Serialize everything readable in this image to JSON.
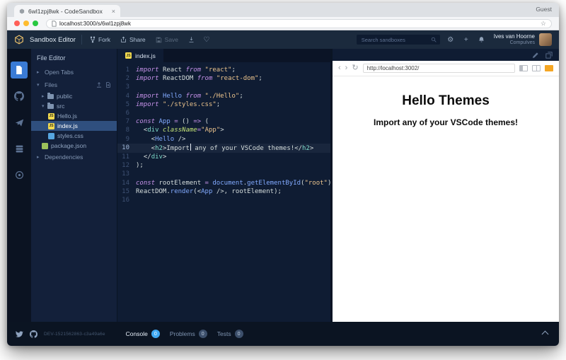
{
  "browser": {
    "tab_title": "6wl1zpj8wk - CodeSandbox",
    "close_tab": "×",
    "guest_label": "Guest",
    "url": "localhost:3000/s/6wl1zpj8wk"
  },
  "glyphs": {
    "heart": "♡",
    "gear": "⚙",
    "plus": "+",
    "star": "☆",
    "back": "‹",
    "forward": "›",
    "refresh": "↻",
    "chev_right": "▸",
    "chev_down": "▾"
  },
  "header": {
    "app_title": "Sandbox Editor",
    "actions": {
      "fork": "Fork",
      "share": "Share",
      "save": "Save"
    },
    "search_placeholder": "Search sandboxes",
    "user": {
      "name": "Ives van Hoorne",
      "handle": "CompuIves"
    }
  },
  "rail": {
    "items": [
      {
        "name": "files",
        "selected": true
      },
      {
        "name": "github",
        "selected": false
      },
      {
        "name": "deploy",
        "selected": false
      },
      {
        "name": "server",
        "selected": false
      },
      {
        "name": "live",
        "selected": false
      }
    ]
  },
  "explorer": {
    "title": "File Editor",
    "sections": {
      "open_tabs": "Open Tabs",
      "files": "Files",
      "dependencies": "Dependencies"
    },
    "items": [
      {
        "label": "public",
        "type": "folder",
        "depth": 1,
        "selected": false
      },
      {
        "label": "src",
        "type": "folder-open",
        "depth": 1,
        "selected": false
      },
      {
        "label": "Hello.js",
        "type": "js",
        "depth": 2,
        "selected": false
      },
      {
        "label": "index.js",
        "type": "js",
        "depth": 2,
        "selected": true
      },
      {
        "label": "styles.css",
        "type": "css",
        "depth": 2,
        "selected": false
      },
      {
        "label": "package.json",
        "type": "json",
        "depth": 1,
        "selected": false
      }
    ]
  },
  "editor": {
    "tab_label": "index.js",
    "active_line": 10,
    "lines": [
      [
        [
          "k",
          "import "
        ],
        [
          "v",
          "React "
        ],
        [
          "k",
          "from "
        ],
        [
          "s",
          "\"react\""
        ],
        [
          "p",
          ";"
        ]
      ],
      [
        [
          "k",
          "import "
        ],
        [
          "v",
          "ReactDOM "
        ],
        [
          "k",
          "from "
        ],
        [
          "s",
          "\"react-dom\""
        ],
        [
          "p",
          ";"
        ]
      ],
      [],
      [
        [
          "k",
          "import "
        ],
        [
          "f",
          "Hello "
        ],
        [
          "k",
          "from "
        ],
        [
          "s",
          "\"./Hello\""
        ],
        [
          "p",
          ";"
        ]
      ],
      [
        [
          "k",
          "import "
        ],
        [
          "s",
          "\"./styles.css\""
        ],
        [
          "p",
          ";"
        ]
      ],
      [],
      [
        [
          "k",
          "const "
        ],
        [
          "f",
          "App "
        ],
        [
          "o",
          "= "
        ],
        [
          "p",
          "() "
        ],
        [
          "o",
          "=> "
        ],
        [
          "p",
          "("
        ]
      ],
      [
        [
          "p",
          "  <"
        ],
        [
          "t",
          "div"
        ],
        [
          "v",
          " "
        ],
        [
          "a",
          "className"
        ],
        [
          "o",
          "="
        ],
        [
          "s",
          "\"App\""
        ],
        [
          "p",
          ">"
        ]
      ],
      [
        [
          "p",
          "    <"
        ],
        [
          "f",
          "Hello"
        ],
        [
          "p",
          " />"
        ]
      ],
      [
        [
          "p",
          "    <"
        ],
        [
          "t",
          "h2"
        ],
        [
          "p",
          ">"
        ],
        [
          "v",
          "Import"
        ],
        [
          "caret",
          ""
        ],
        [
          "v",
          " any of your VSCode themes!"
        ],
        [
          "p",
          "</"
        ],
        [
          "t",
          "h2"
        ],
        [
          "p",
          ">"
        ]
      ],
      [
        [
          "p",
          "  </"
        ],
        [
          "t",
          "div"
        ],
        [
          "p",
          ">"
        ]
      ],
      [
        [
          "p",
          ");"
        ]
      ],
      [],
      [
        [
          "k",
          "const "
        ],
        [
          "v",
          "rootElement "
        ],
        [
          "o",
          "= "
        ],
        [
          "f",
          "document"
        ],
        [
          "p",
          "."
        ],
        [
          "f",
          "getElementById"
        ],
        [
          "p",
          "("
        ],
        [
          "s",
          "\"root\""
        ],
        [
          "p",
          ");"
        ]
      ],
      [
        [
          "v",
          "ReactDOM"
        ],
        [
          "p",
          "."
        ],
        [
          "f",
          "render"
        ],
        [
          "p",
          "(<"
        ],
        [
          "f",
          "App"
        ],
        [
          "p",
          " />, "
        ],
        [
          "v",
          "rootElement"
        ],
        [
          "p",
          ");"
        ]
      ],
      []
    ]
  },
  "preview": {
    "url": "http://localhost:3002/",
    "heading": "Hello Themes",
    "subheading": "Import any of your VSCode themes!"
  },
  "statusbar": {
    "version": "DEV-1521562863-c3a49a6e",
    "tabs": [
      {
        "label": "Console",
        "count": "0",
        "active": true
      },
      {
        "label": "Problems",
        "count": "0",
        "active": false
      },
      {
        "label": "Tests",
        "count": "0",
        "active": false
      }
    ]
  },
  "colors": {
    "accent": "#40A9F3",
    "rail_active": "#3A7BD5",
    "editor_bg": "#0F1C33",
    "keyword": "#C792EA",
    "string": "#ECC48D",
    "function": "#82AAFF",
    "tag": "#7FDBCA"
  }
}
